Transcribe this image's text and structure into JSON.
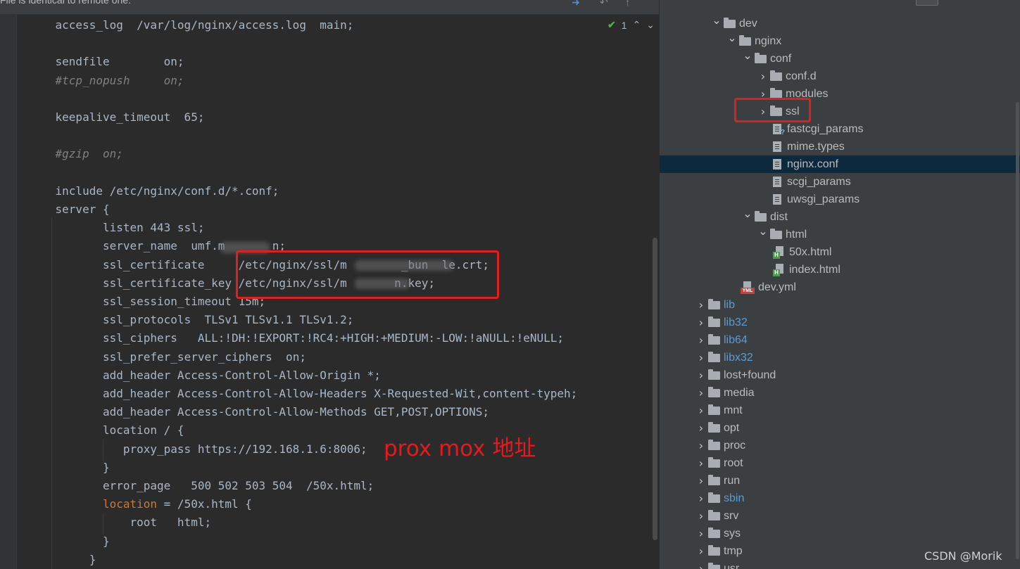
{
  "banner": {
    "message": "File is identical to remote one.",
    "icons": [
      "arrow-right-icon",
      "undo-icon",
      "upload-icon"
    ]
  },
  "inspection": {
    "icon": "check-icon",
    "count": "1"
  },
  "code_lines": [
    {
      "indent": "    ",
      "parts": [
        {
          "t": "access_log  /var/log/nginx/access.log  main;",
          "c": "txt"
        }
      ]
    },
    {
      "indent": "",
      "parts": []
    },
    {
      "indent": "    ",
      "parts": [
        {
          "t": "sendfile        on;",
          "c": "txt"
        }
      ]
    },
    {
      "indent": "    ",
      "parts": [
        {
          "t": "#tcp_nopush     on;",
          "c": "cm"
        }
      ]
    },
    {
      "indent": "",
      "parts": []
    },
    {
      "indent": "    ",
      "parts": [
        {
          "t": "keepalive_timeout  65;",
          "c": "txt"
        }
      ]
    },
    {
      "indent": "",
      "parts": []
    },
    {
      "indent": "    ",
      "parts": [
        {
          "t": "#gzip  on;",
          "c": "cm"
        }
      ]
    },
    {
      "indent": "",
      "parts": []
    },
    {
      "indent": "    ",
      "parts": [
        {
          "t": "include /etc/nginx/conf.d/*.conf;",
          "c": "txt"
        }
      ]
    },
    {
      "indent": "    ",
      "parts": [
        {
          "t": "server {",
          "c": "txt"
        }
      ]
    },
    {
      "indent": "           ",
      "parts": [
        {
          "t": "listen 443 ssl;",
          "c": "txt"
        }
      ]
    },
    {
      "indent": "           ",
      "parts": [
        {
          "t": "server_name  umf.m       n;",
          "c": "txt"
        }
      ]
    },
    {
      "indent": "           ",
      "parts": [
        {
          "t": "ssl_certificate     /etc/nginx/ssl/m        _bun  le.crt;",
          "c": "txt"
        }
      ]
    },
    {
      "indent": "           ",
      "parts": [
        {
          "t": "ssl_certificate_key /etc/nginx/ssl/m       n.key;",
          "c": "txt"
        }
      ]
    },
    {
      "indent": "           ",
      "parts": [
        {
          "t": "ssl_session_timeout 15m;",
          "c": "txt"
        }
      ]
    },
    {
      "indent": "           ",
      "parts": [
        {
          "t": "ssl_protocols  TLSv1 TLSv1.1 TLSv1.2;",
          "c": "txt"
        }
      ]
    },
    {
      "indent": "           ",
      "parts": [
        {
          "t": "ssl_ciphers   ALL:!DH:!EXPORT:!RC4:+HIGH:+MEDIUM:-LOW:!aNULL:!eNULL;",
          "c": "txt"
        }
      ]
    },
    {
      "indent": "           ",
      "parts": [
        {
          "t": "ssl_prefer_server_ciphers  on;",
          "c": "txt"
        }
      ]
    },
    {
      "indent": "           ",
      "parts": [
        {
          "t": "add_header Access-Control-Allow-Origin *;",
          "c": "txt"
        }
      ]
    },
    {
      "indent": "           ",
      "parts": [
        {
          "t": "add_header Access-Control-Allow-Headers X-Requested-Wit,content-typeh;",
          "c": "txt"
        }
      ]
    },
    {
      "indent": "           ",
      "parts": [
        {
          "t": "add_header Access-Control-Allow-Methods GET,POST,OPTIONS;",
          "c": "txt"
        }
      ]
    },
    {
      "indent": "           ",
      "parts": [
        {
          "t": "location / {",
          "c": "txt"
        }
      ]
    },
    {
      "indent": "              ",
      "parts": [
        {
          "t": "proxy_pass https://192.168.1.6:8006;",
          "c": "txt"
        }
      ]
    },
    {
      "indent": "           ",
      "parts": [
        {
          "t": "}",
          "c": "txt"
        }
      ]
    },
    {
      "indent": "           ",
      "parts": [
        {
          "t": "error_page   500 502 503 504  /50x.html;",
          "c": "txt"
        }
      ]
    },
    {
      "indent": "           ",
      "parts": [
        {
          "t": "location",
          "c": "kw"
        },
        {
          "t": " = /50x.html {",
          "c": "txt"
        }
      ]
    },
    {
      "indent": "               ",
      "parts": [
        {
          "t": "root   html;",
          "c": "txt"
        }
      ]
    },
    {
      "indent": "           ",
      "parts": [
        {
          "t": "}",
          "c": "txt"
        }
      ]
    },
    {
      "indent": "         ",
      "parts": [
        {
          "t": "}",
          "c": "txt"
        }
      ]
    }
  ],
  "annotation": "prox mox 地址",
  "tree": {
    "items": [
      {
        "label": "dev",
        "type": "folder",
        "depth": 2,
        "arrow": "down"
      },
      {
        "label": "nginx",
        "type": "folder",
        "depth": 3,
        "arrow": "down"
      },
      {
        "label": "conf",
        "type": "folder",
        "depth": 4,
        "arrow": "down"
      },
      {
        "label": "conf.d",
        "type": "folder",
        "depth": 5,
        "arrow": "right"
      },
      {
        "label": "modules",
        "type": "folder",
        "depth": 5,
        "arrow": "right"
      },
      {
        "label": "ssl",
        "type": "folder",
        "depth": 5,
        "arrow": "right"
      },
      {
        "label": "fastcgi_params",
        "type": "file-unknown",
        "depth": 5
      },
      {
        "label": "mime.types",
        "type": "file",
        "depth": 5
      },
      {
        "label": "nginx.conf",
        "type": "file",
        "depth": 5,
        "selected": true
      },
      {
        "label": "scgi_params",
        "type": "file",
        "depth": 5
      },
      {
        "label": "uwsgi_params",
        "type": "file",
        "depth": 5
      },
      {
        "label": "dist",
        "type": "folder",
        "depth": 4,
        "arrow": "down"
      },
      {
        "label": "html",
        "type": "folder",
        "depth": 5,
        "arrow": "down"
      },
      {
        "label": "50x.html",
        "type": "html",
        "depth": 6
      },
      {
        "label": "index.html",
        "type": "html",
        "depth": 6
      },
      {
        "label": "dev.yml",
        "type": "yml",
        "depth": 4
      },
      {
        "label": "lib",
        "type": "folder",
        "depth": 1,
        "arrow": "right",
        "blue": true
      },
      {
        "label": "lib32",
        "type": "folder",
        "depth": 1,
        "arrow": "right",
        "blue": true
      },
      {
        "label": "lib64",
        "type": "folder",
        "depth": 1,
        "arrow": "right",
        "blue": true
      },
      {
        "label": "libx32",
        "type": "folder",
        "depth": 1,
        "arrow": "right",
        "blue": true
      },
      {
        "label": "lost+found",
        "type": "folder",
        "depth": 1,
        "arrow": "right"
      },
      {
        "label": "media",
        "type": "folder",
        "depth": 1,
        "arrow": "right"
      },
      {
        "label": "mnt",
        "type": "folder",
        "depth": 1,
        "arrow": "right"
      },
      {
        "label": "opt",
        "type": "folder",
        "depth": 1,
        "arrow": "right"
      },
      {
        "label": "proc",
        "type": "folder",
        "depth": 1,
        "arrow": "right"
      },
      {
        "label": "root",
        "type": "folder",
        "depth": 1,
        "arrow": "right"
      },
      {
        "label": "run",
        "type": "folder",
        "depth": 1,
        "arrow": "right"
      },
      {
        "label": "sbin",
        "type": "folder",
        "depth": 1,
        "arrow": "right",
        "blue": true
      },
      {
        "label": "srv",
        "type": "folder",
        "depth": 1,
        "arrow": "right"
      },
      {
        "label": "sys",
        "type": "folder",
        "depth": 1,
        "arrow": "right"
      },
      {
        "label": "tmp",
        "type": "folder",
        "depth": 1,
        "arrow": "right"
      },
      {
        "label": "usr",
        "type": "folder",
        "depth": 1,
        "arrow": "right"
      }
    ]
  },
  "watermark": "CSDN @Morik",
  "colors": {
    "editor_bg": "#2b2b2b",
    "tree_bg": "#3c3f41",
    "selection": "#0d293e",
    "highlight_box": "#e02020",
    "annotation": "#e8191e",
    "link_folder": "#5b9bd5"
  }
}
